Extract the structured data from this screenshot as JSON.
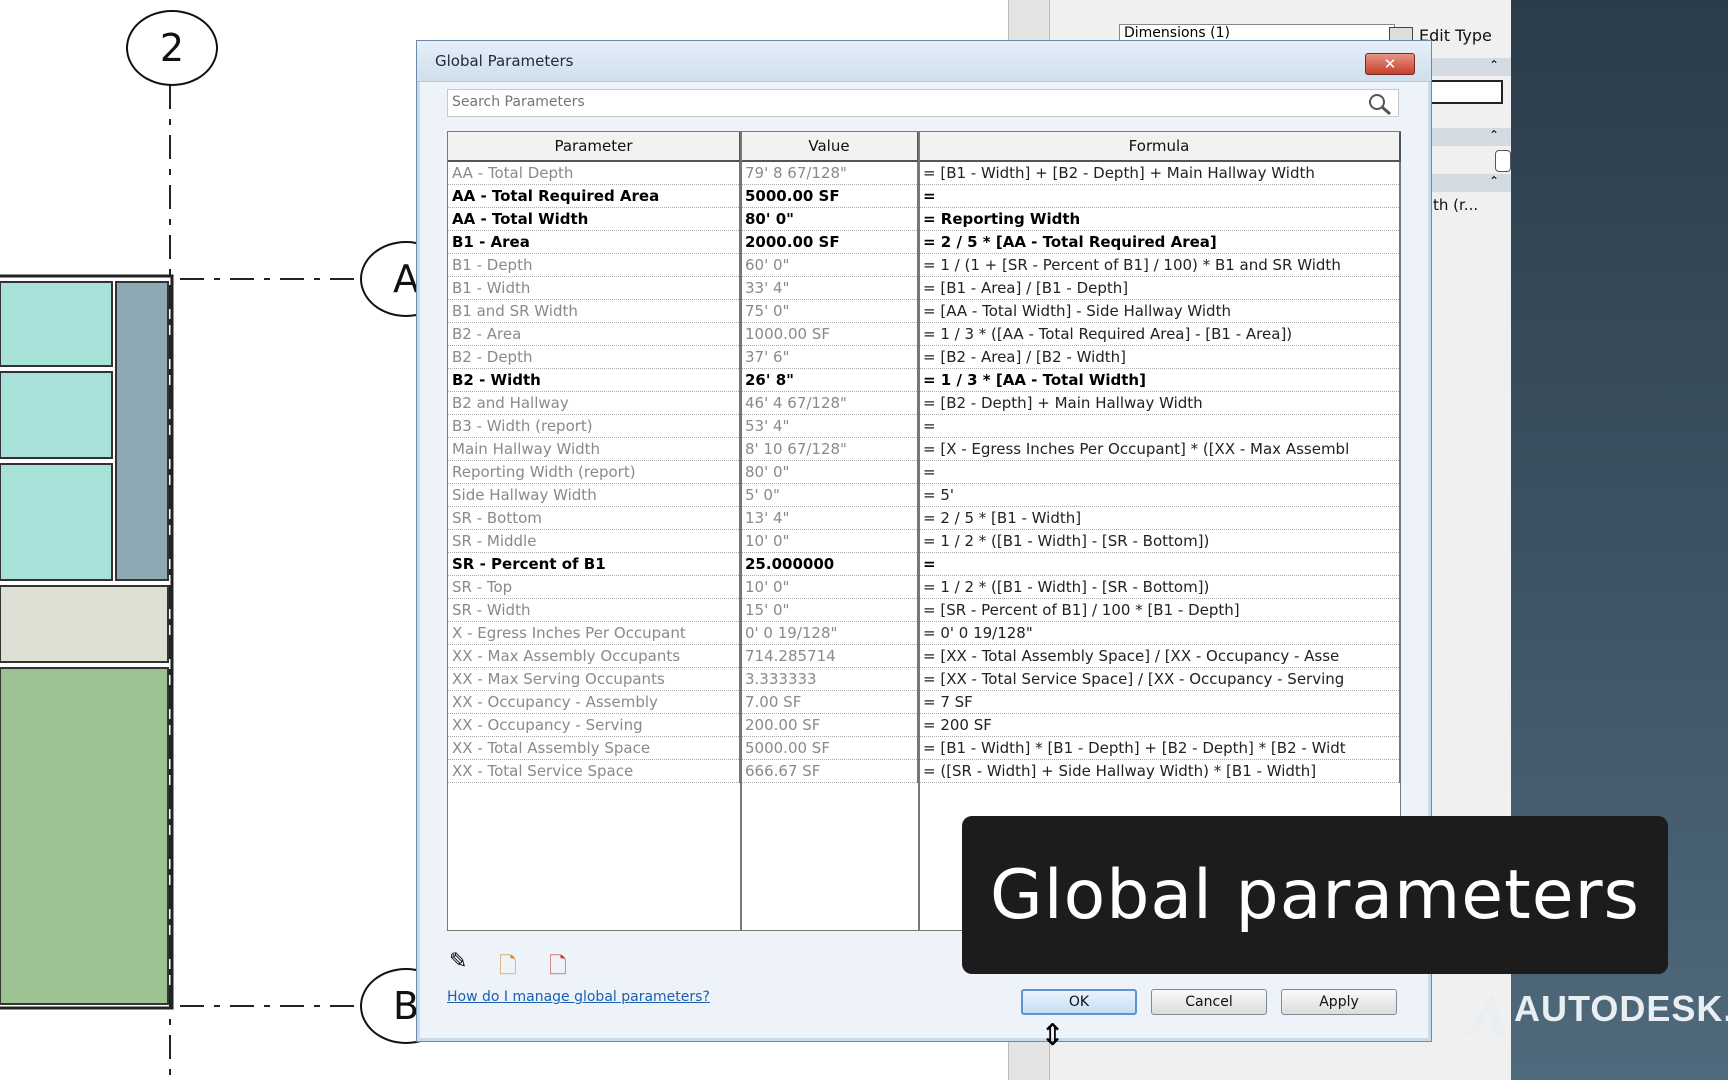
{
  "canvas": {
    "grid_bubbles": [
      "2",
      "A",
      "B"
    ]
  },
  "props_panel": {
    "dropdown": "Dimensions (1)",
    "edit_type": "Edit Type",
    "truncated_label": "th (r..."
  },
  "dialog": {
    "title": "Global Parameters",
    "close_symbol": "✕",
    "search_placeholder": "Search Parameters",
    "columns": [
      "Parameter",
      "Value",
      "Formula"
    ],
    "rows": [
      {
        "p": "AA - Total Depth",
        "v": "79'  8 67/128\"",
        "f": "= [B1 - Width] + [B2 - Depth] + Main Hallway Width",
        "bold": false
      },
      {
        "p": "AA - Total Required Area",
        "v": "5000.00 SF",
        "f": "=",
        "bold": true
      },
      {
        "p": "AA - Total Width",
        "v": "80'  0\"",
        "f": "= Reporting Width",
        "bold": true
      },
      {
        "p": "B1 - Area",
        "v": "2000.00 SF",
        "f": "= 2 / 5 * [AA - Total Required Area]",
        "bold": true
      },
      {
        "p": "B1 - Depth",
        "v": "60'  0\"",
        "f": "= 1 / (1 + [SR - Percent of B1] / 100) * B1 and SR Width",
        "bold": false
      },
      {
        "p": "B1 - Width",
        "v": "33'  4\"",
        "f": "= [B1 - Area] / [B1 - Depth]",
        "bold": false
      },
      {
        "p": "B1 and SR Width",
        "v": "75'  0\"",
        "f": "= [AA - Total Width] - Side Hallway Width",
        "bold": false
      },
      {
        "p": "B2 - Area",
        "v": "1000.00 SF",
        "f": "= 1 / 3 * ([AA - Total Required Area] - [B1 - Area])",
        "bold": false
      },
      {
        "p": "B2 - Depth",
        "v": "37'  6\"",
        "f": "= [B2 - Area] / [B2 - Width]",
        "bold": false
      },
      {
        "p": "B2 - Width",
        "v": "26'  8\"",
        "f": "= 1 / 3 * [AA - Total Width]",
        "bold": true
      },
      {
        "p": "B2 and Hallway",
        "v": "46'  4 67/128\"",
        "f": "= [B2 - Depth] + Main Hallway Width",
        "bold": false
      },
      {
        "p": "B3 - Width (report)",
        "v": "53'  4\"",
        "f": "=",
        "bold": false
      },
      {
        "p": "Main Hallway Width",
        "v": "8'  10 67/128\"",
        "f": "= [X - Egress Inches Per Occupant] * ([XX - Max Assembl",
        "bold": false
      },
      {
        "p": "Reporting Width (report)",
        "v": "80'  0\"",
        "f": "=",
        "bold": false
      },
      {
        "p": "Side Hallway Width",
        "v": "5'  0\"",
        "f": "= 5'",
        "bold": false
      },
      {
        "p": "SR - Bottom",
        "v": "13'  4\"",
        "f": "= 2 / 5 * [B1 - Width]",
        "bold": false
      },
      {
        "p": "SR - Middle",
        "v": "10'  0\"",
        "f": "= 1 / 2 * ([B1 - Width] - [SR - Bottom])",
        "bold": false
      },
      {
        "p": "SR - Percent of B1",
        "v": "25.000000",
        "f": "=",
        "bold": true
      },
      {
        "p": "SR - Top",
        "v": "10'  0\"",
        "f": "= 1 / 2 * ([B1 - Width] - [SR - Bottom])",
        "bold": false
      },
      {
        "p": "SR - Width",
        "v": "15'  0\"",
        "f": "= [SR - Percent of B1] / 100 * [B1 - Depth]",
        "bold": false
      },
      {
        "p": "X - Egress Inches Per Occupant",
        "v": "0'  0 19/128\"",
        "f": "= 0'  0 19/128\"",
        "bold": false
      },
      {
        "p": "XX - Max Assembly Occupants",
        "v": "714.285714",
        "f": "= [XX - Total Assembly Space] / [XX - Occupancy - Asse",
        "bold": false
      },
      {
        "p": "XX - Max Serving Occupants",
        "v": "3.333333",
        "f": "= [XX - Total Service Space] / [XX - Occupancy - Serving",
        "bold": false
      },
      {
        "p": "XX - Occupancy - Assembly",
        "v": "7.00 SF",
        "f": "= 7 SF",
        "bold": false
      },
      {
        "p": "XX - Occupancy - Serving",
        "v": "200.00 SF",
        "f": "= 200 SF",
        "bold": false
      },
      {
        "p": "XX - Total Assembly Space",
        "v": "5000.00 SF",
        "f": "= [B1 - Width] * [B1 - Depth] + [B2 - Depth] * [B2 - Widt",
        "bold": false
      },
      {
        "p": "XX - Total Service Space",
        "v": "666.67 SF",
        "f": "= ([SR - Width] + Side Hallway Width) * [B1 - Width]",
        "bold": false
      }
    ],
    "help_link": "How do I manage global parameters?",
    "ok": "OK",
    "cancel": "Cancel",
    "apply": "Apply"
  },
  "caption": "Global parameters",
  "brand": "AUTODESK."
}
